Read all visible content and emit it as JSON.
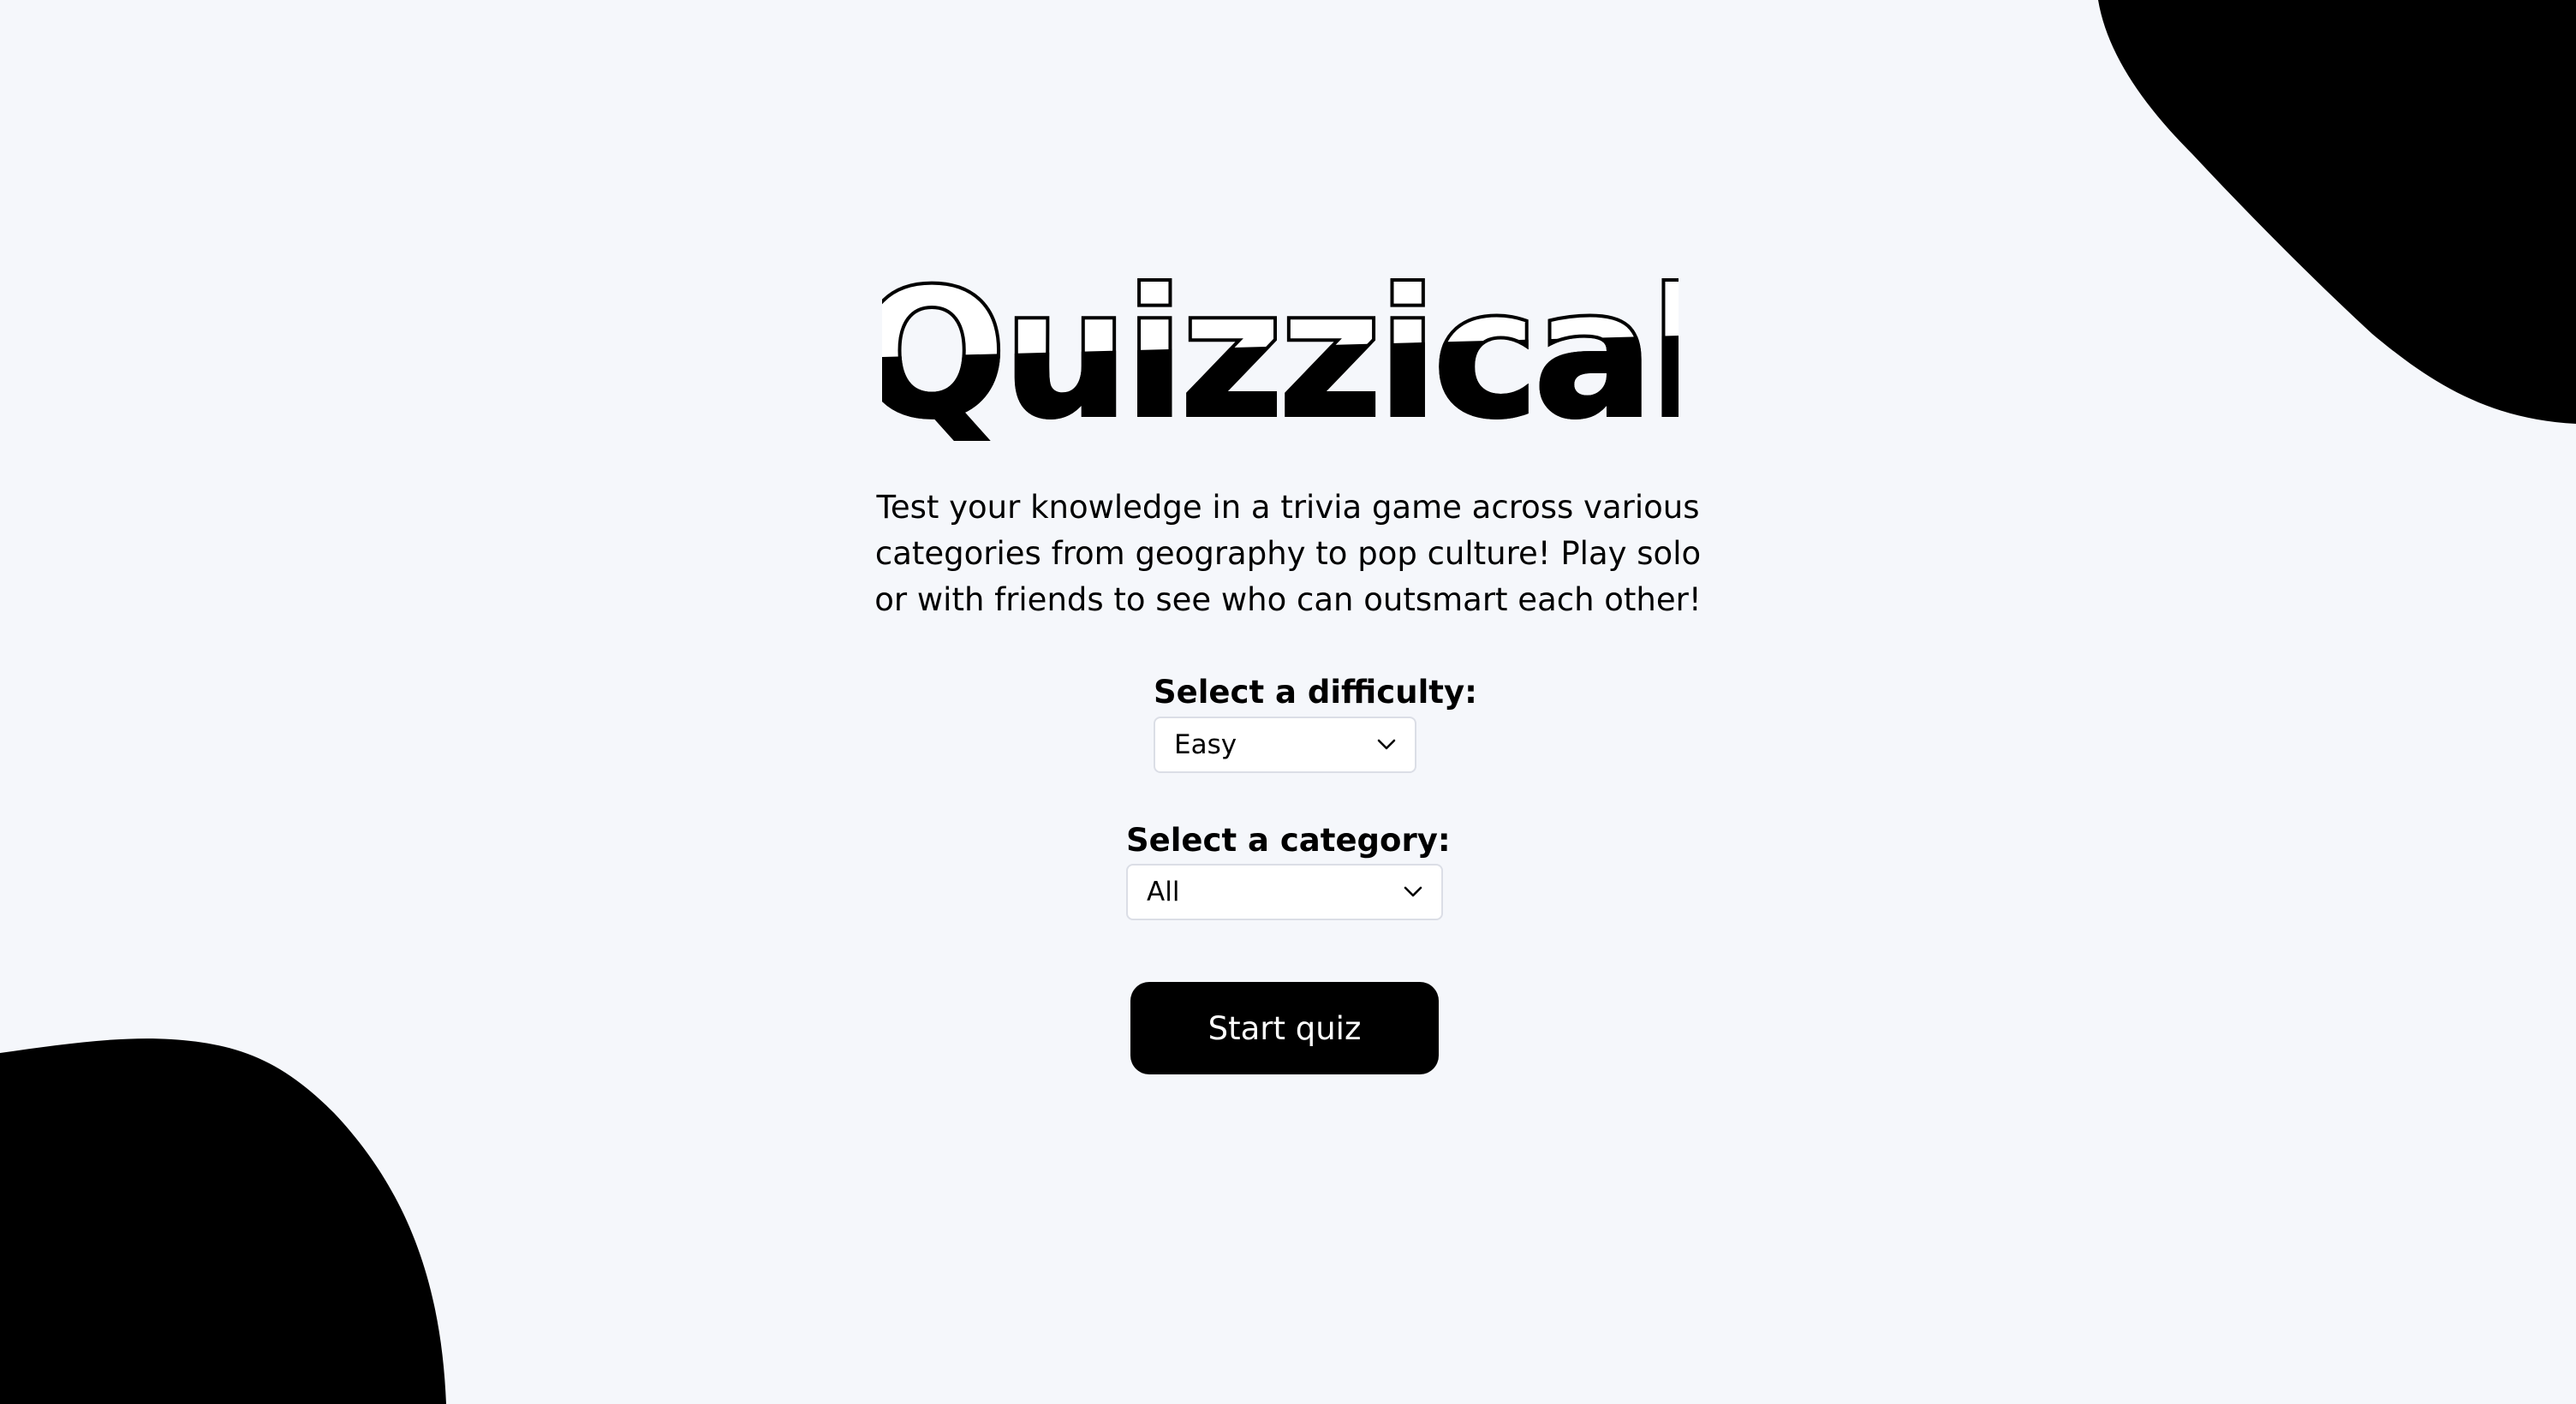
{
  "app": {
    "title": "Quizzical",
    "intro": "Test your knowledge in a trivia game across various categories from geography to pop culture! Play solo or with friends to see who can outsmart each other!"
  },
  "form": {
    "difficulty": {
      "label": "Select a difficulty:",
      "value": "Easy"
    },
    "category": {
      "label": "Select a category:",
      "value": "All"
    },
    "start_label": "Start quiz"
  },
  "icons": {
    "dropdown": "chevron-down-icon"
  },
  "colors": {
    "background": "#F5F7FB",
    "accent": "#000000",
    "button_text": "#FFFFFF",
    "select_border": "#DBDEE6"
  }
}
